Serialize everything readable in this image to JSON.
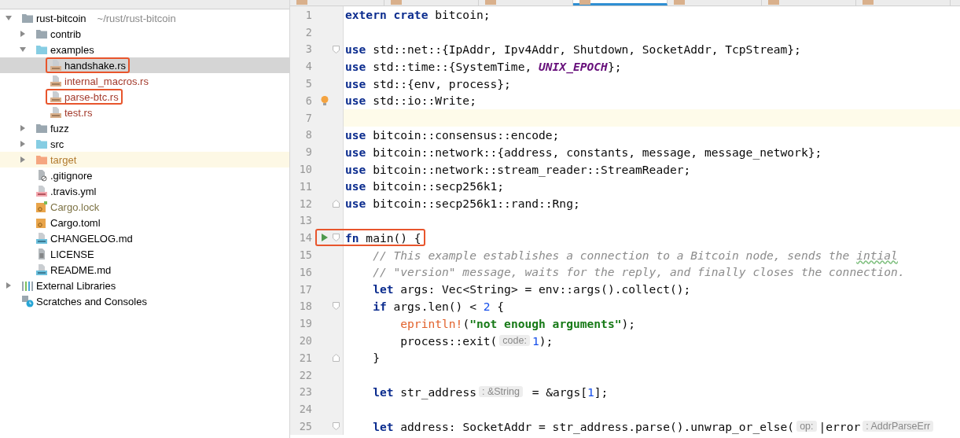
{
  "editor_tabs": [
    {
      "selected": false
    },
    {
      "selected": false
    },
    {
      "selected": false
    },
    {
      "selected": true
    },
    {
      "selected": false
    },
    {
      "selected": false
    },
    {
      "selected": false
    }
  ],
  "project_tree": [
    {
      "name": "rust-bitcoin",
      "path": "~/rust/rust-bitcoin",
      "kind": "folder",
      "expanded": true,
      "selected": false,
      "boxed": false,
      "color": "#000000",
      "children": [
        {
          "name": "contrib",
          "kind": "folder",
          "expanded": false,
          "selected": false,
          "boxed": false,
          "color": "#000000"
        },
        {
          "name": "examples",
          "kind": "source-folder",
          "expanded": true,
          "selected": false,
          "boxed": false,
          "color": "#000000",
          "children": [
            {
              "name": "handshake.rs",
              "kind": "rs",
              "selected": true,
              "boxed": true,
              "color": "#000000"
            },
            {
              "name": "internal_macros.rs",
              "kind": "rs",
              "selected": false,
              "boxed": false,
              "color": "#a33a2c"
            },
            {
              "name": "parse-btc.rs",
              "kind": "rs",
              "selected": false,
              "boxed": true,
              "color": "#a33a2c"
            },
            {
              "name": "test.rs",
              "kind": "rs",
              "selected": false,
              "boxed": false,
              "color": "#a33a2c"
            }
          ]
        },
        {
          "name": "fuzz",
          "kind": "folder",
          "expanded": false,
          "selected": false,
          "boxed": false,
          "color": "#000000"
        },
        {
          "name": "src",
          "kind": "source-folder",
          "expanded": false,
          "selected": false,
          "boxed": false
        },
        {
          "name": "target",
          "kind": "excluded-folder",
          "expanded": false,
          "selected": false,
          "boxed": false,
          "color": "#b27a2e"
        },
        {
          "name": ".gitignore",
          "kind": "ignore",
          "selected": false,
          "boxed": false,
          "color": "#000000"
        },
        {
          "name": ".travis.yml",
          "kind": "yml",
          "selected": false,
          "boxed": false,
          "color": "#000000"
        },
        {
          "name": "Cargo.lock",
          "kind": "lock",
          "selected": false,
          "boxed": false,
          "color": "#7d7345"
        },
        {
          "name": "Cargo.toml",
          "kind": "toml",
          "selected": false,
          "boxed": false,
          "color": "#000000"
        },
        {
          "name": "CHANGELOG.md",
          "kind": "md",
          "selected": false,
          "boxed": false,
          "color": "#000000"
        },
        {
          "name": "LICENSE",
          "kind": "text",
          "selected": false,
          "boxed": false,
          "color": "#000000"
        },
        {
          "name": "README.md",
          "kind": "md",
          "selected": false,
          "boxed": false,
          "color": "#000000"
        }
      ]
    },
    {
      "name": "External Libraries",
      "kind": "libraries",
      "expanded": false,
      "selected": false,
      "boxed": false,
      "color": "#000000"
    },
    {
      "name": "Scratches and Consoles",
      "kind": "scratches",
      "selected": false,
      "boxed": false,
      "color": "#000000"
    }
  ],
  "code_lines": [
    {
      "number": "1",
      "tokens": [
        {
          "kind": "keyword",
          "text": "extern crate"
        },
        {
          "kind": "plain",
          "text": " bitcoin;"
        }
      ]
    },
    {
      "number": "2"
    },
    {
      "number": "3",
      "fold_start": true,
      "tokens": [
        {
          "kind": "keyword",
          "text": "use"
        },
        {
          "kind": "plain",
          "text": " std::net::{IpAddr, Ipv4Addr, Shutdown, SocketAddr, TcpStream};"
        }
      ]
    },
    {
      "number": "4",
      "tokens": [
        {
          "kind": "keyword",
          "text": "use"
        },
        {
          "kind": "plain",
          "text": " std::time::{SystemTime, "
        },
        {
          "kind": "constant",
          "text": "UNIX_EPOCH"
        },
        {
          "kind": "plain",
          "text": "};"
        }
      ]
    },
    {
      "number": "5",
      "tokens": [
        {
          "kind": "keyword",
          "text": "use"
        },
        {
          "kind": "plain",
          "text": " std::{env, process};"
        }
      ]
    },
    {
      "number": "6",
      "bulb": true,
      "tokens": [
        {
          "kind": "keyword",
          "text": "use"
        },
        {
          "kind": "plain",
          "text": " std::io::Write;"
        }
      ]
    },
    {
      "number": "7",
      "current": true
    },
    {
      "number": "8",
      "tokens": [
        {
          "kind": "keyword",
          "text": "use"
        },
        {
          "kind": "plain",
          "text": " bitcoin::consensus::encode;"
        }
      ]
    },
    {
      "number": "9",
      "tokens": [
        {
          "kind": "keyword",
          "text": "use"
        },
        {
          "kind": "plain",
          "text": " bitcoin::network::{address, constants, message, message_network};"
        }
      ]
    },
    {
      "number": "10",
      "tokens": [
        {
          "kind": "keyword",
          "text": "use"
        },
        {
          "kind": "plain",
          "text": " bitcoin::network::stream_reader::StreamReader;"
        }
      ]
    },
    {
      "number": "11",
      "tokens": [
        {
          "kind": "keyword",
          "text": "use"
        },
        {
          "kind": "plain",
          "text": " bitcoin::secp256k1;"
        }
      ]
    },
    {
      "number": "12",
      "fold_end": true,
      "tokens": [
        {
          "kind": "keyword",
          "text": "use"
        },
        {
          "kind": "plain",
          "text": " bitcoin::secp256k1::rand::Rng;"
        }
      ]
    },
    {
      "number": "13"
    },
    {
      "number": "14",
      "fold_start": true,
      "run": true,
      "boxed": true,
      "tokens": [
        {
          "kind": "keyword",
          "text": "fn"
        },
        {
          "kind": "plain",
          "text": " main() {"
        }
      ]
    },
    {
      "number": "15",
      "tokens": [
        {
          "kind": "comment",
          "text": "    // This example establishes a connection to a Bitcoin node, sends the "
        },
        {
          "kind": "typo",
          "text": "intial"
        }
      ]
    },
    {
      "number": "16",
      "tokens": [
        {
          "kind": "comment",
          "text": "    // \"version\" message, waits for the reply, and finally closes the connection."
        }
      ]
    },
    {
      "number": "17",
      "tokens": [
        {
          "kind": "keyword",
          "text": "    let"
        },
        {
          "kind": "plain",
          "text": " args: Vec<String> = env::args().collect();"
        }
      ]
    },
    {
      "number": "18",
      "fold_start": true,
      "tokens": [
        {
          "kind": "keyword",
          "text": "    if"
        },
        {
          "kind": "plain",
          "text": " args.len() < "
        },
        {
          "kind": "number",
          "text": "2"
        },
        {
          "kind": "plain",
          "text": " {"
        }
      ]
    },
    {
      "number": "19",
      "tokens": [
        {
          "kind": "macro",
          "text": "        eprintln!"
        },
        {
          "kind": "plain",
          "text": "("
        },
        {
          "kind": "string",
          "text": "\"not enough arguments\""
        },
        {
          "kind": "plain",
          "text": ");"
        }
      ]
    },
    {
      "number": "20",
      "tokens": [
        {
          "kind": "plain",
          "text": "        process::exit("
        },
        {
          "kind": "hint",
          "text": "code:"
        },
        {
          "kind": "number",
          "text": "1"
        },
        {
          "kind": "plain",
          "text": ");"
        }
      ]
    },
    {
      "number": "21",
      "fold_end": true,
      "tokens": [
        {
          "kind": "plain",
          "text": "    }"
        }
      ]
    },
    {
      "number": "22"
    },
    {
      "number": "23",
      "tokens": [
        {
          "kind": "keyword",
          "text": "    let"
        },
        {
          "kind": "plain",
          "text": " str_address"
        },
        {
          "kind": "hint",
          "text": ": &String"
        },
        {
          "kind": "plain",
          "text": " = &args["
        },
        {
          "kind": "number",
          "text": "1"
        },
        {
          "kind": "plain",
          "text": "];"
        }
      ]
    },
    {
      "number": "24"
    },
    {
      "number": "25",
      "fold_start": true,
      "tokens": [
        {
          "kind": "keyword",
          "text": "    let"
        },
        {
          "kind": "plain",
          "text": " address: SocketAddr = str_address.parse().unwrap_or_else("
        },
        {
          "kind": "hint",
          "text": "op:"
        },
        {
          "kind": "plain",
          "text": "|error"
        },
        {
          "kind": "hint",
          "text": ": AddrParseErr"
        }
      ]
    }
  ]
}
